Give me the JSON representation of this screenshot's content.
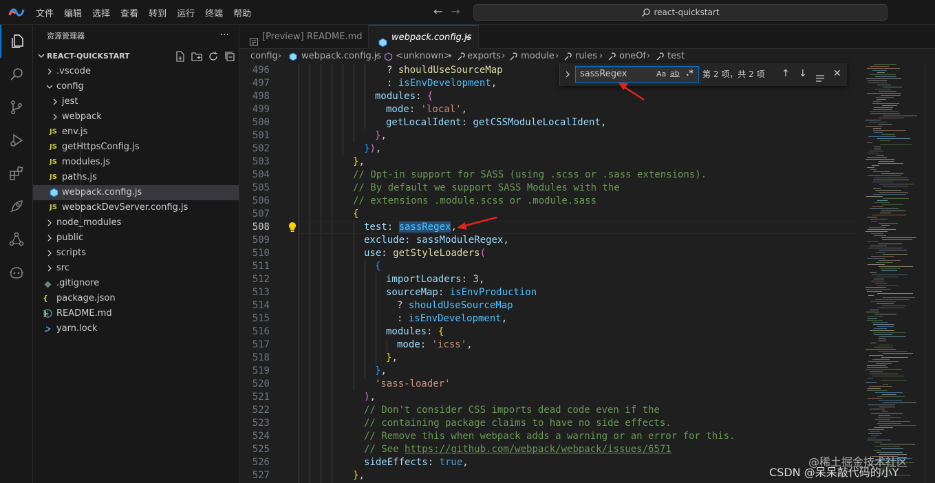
{
  "menubar": {
    "items": [
      "文件",
      "编辑",
      "选择",
      "查看",
      "转到",
      "运行",
      "终端",
      "帮助"
    ]
  },
  "command_center": {
    "text": "react-quickstart"
  },
  "sidebar": {
    "header": "资源管理器",
    "more": "···",
    "section_title": "REACT-QUICKSTART",
    "tree": [
      {
        "label": ".vscode",
        "kind": "folder",
        "expanded": false
      },
      {
        "label": "config",
        "kind": "folder",
        "expanded": true
      },
      {
        "label": "jest",
        "kind": "folder",
        "expanded": false
      },
      {
        "label": "webpack",
        "kind": "folder",
        "expanded": false
      },
      {
        "label": "env.js",
        "kind": "js"
      },
      {
        "label": "getHttpsConfig.js",
        "kind": "js"
      },
      {
        "label": "modules.js",
        "kind": "js"
      },
      {
        "label": "paths.js",
        "kind": "js"
      },
      {
        "label": "webpack.config.js",
        "kind": "webpack",
        "selected": true
      },
      {
        "label": "webpackDevServer.config.js",
        "kind": "js"
      },
      {
        "label": "node_modules",
        "kind": "folder",
        "expanded": false
      },
      {
        "label": "public",
        "kind": "folder",
        "expanded": false
      },
      {
        "label": "scripts",
        "kind": "folder",
        "expanded": false
      },
      {
        "label": "src",
        "kind": "folder",
        "expanded": false
      },
      {
        "label": ".gitignore",
        "kind": "git"
      },
      {
        "label": "package.json",
        "kind": "json"
      },
      {
        "label": "README.md",
        "kind": "info"
      },
      {
        "label": "yarn.lock",
        "kind": "yarn"
      }
    ],
    "js_badge": "JS",
    "json_badge": "{ }"
  },
  "tabs": [
    {
      "label": "[Preview] README.md",
      "active": false
    },
    {
      "label": "webpack.config.js",
      "active": true,
      "close": "×"
    }
  ],
  "breadcrumbs": [
    "config",
    "webpack.config.js",
    "<unknown>",
    "exports",
    "module",
    "rules",
    "oneOf",
    "test"
  ],
  "find_widget": {
    "query": "sassRegex",
    "case_label": "Aa",
    "word_label": "ab",
    "regex_label": ".*",
    "result_count": "第 2 项，共 2 项"
  },
  "code": {
    "current_line": "508",
    "lines": [
      {
        "n": "496"
      },
      {
        "n": "497"
      },
      {
        "n": "498"
      },
      {
        "n": "499"
      },
      {
        "n": "500"
      },
      {
        "n": "501"
      },
      {
        "n": "502"
      },
      {
        "n": "503"
      },
      {
        "n": "504"
      },
      {
        "n": "505"
      },
      {
        "n": "506"
      },
      {
        "n": "507"
      },
      {
        "n": "508"
      },
      {
        "n": "509"
      },
      {
        "n": "510"
      },
      {
        "n": "511"
      },
      {
        "n": "512"
      },
      {
        "n": "513"
      },
      {
        "n": "514"
      },
      {
        "n": "515"
      },
      {
        "n": "516"
      },
      {
        "n": "517"
      },
      {
        "n": "518"
      },
      {
        "n": "519"
      },
      {
        "n": "520"
      },
      {
        "n": "521"
      },
      {
        "n": "522"
      },
      {
        "n": "523"
      },
      {
        "n": "524"
      },
      {
        "n": "525"
      },
      {
        "n": "526"
      },
      {
        "n": "527"
      }
    ],
    "tokens": {
      "l496_q": "? ",
      "l496_a": "shouldUseSourceMap",
      "l497_c": ": ",
      "l497_a": "isEnvDevelopment",
      "l497_e": ",",
      "l498_a": "modules",
      "l498_b": ": ",
      "l498_c": "{",
      "l499_a": "mode",
      "l499_b": ": ",
      "l499_c": "'local'",
      "l499_d": ",",
      "l500_a": "getLocalIdent",
      "l500_b": ": ",
      "l500_c": "getCSSModuleLocalIdent",
      "l500_d": ",",
      "l501_a": "}",
      "l501_b": ",",
      "l502_a": "}",
      "l502_b": ")",
      "l502_c": ",",
      "l503_a": "}",
      "l503_b": ",",
      "l504": "// Opt-in support for SASS (using .scss or .sass extensions).",
      "l505": "// By default we support SASS Modules with the",
      "l506": "// extensions .module.scss or .module.sass",
      "l507": "{",
      "l508_a": "test",
      "l508_b": ": ",
      "l508_c": "sassRegex",
      "l508_d": ",",
      "l509_a": "exclude",
      "l509_b": ": ",
      "l509_c": "sassModuleRegex",
      "l509_d": ",",
      "l510_a": "use",
      "l510_b": ": ",
      "l510_c": "getStyleLoaders",
      "l510_d": "(",
      "l511": "{",
      "l512_a": "importLoaders",
      "l512_b": ": ",
      "l512_c": "3",
      "l512_d": ",",
      "l513_a": "sourceMap",
      "l513_b": ": ",
      "l513_c": "isEnvProduction",
      "l514_q": "? ",
      "l514_a": "shouldUseSourceMap",
      "l515_c": ": ",
      "l515_a": "isEnvDevelopment",
      "l515_e": ",",
      "l516_a": "modules",
      "l516_b": ": ",
      "l516_c": "{",
      "l517_a": "mode",
      "l517_b": ": ",
      "l517_c": "'icss'",
      "l517_d": ",",
      "l518_a": "}",
      "l518_b": ",",
      "l519_a": "}",
      "l519_b": ",",
      "l520": "'sass-loader'",
      "l521_a": ")",
      "l521_b": ",",
      "l522": "// Don't consider CSS imports dead code even if the",
      "l523": "// containing package claims to have no side effects.",
      "l524": "// Remove this when webpack adds a warning or an error for this.",
      "l525_a": "// See ",
      "l525_b": "https://github.com/webpack/webpack/issues/6571",
      "l526_a": "sideEffects",
      "l526_b": ": ",
      "l526_c": "true",
      "l526_d": ",",
      "l527_a": "}",
      "l527_b": ","
    }
  },
  "watermark": {
    "line1": "@稀土掘金技术社区",
    "line2": "CSDN @呆呆敲代码的小Y"
  },
  "colors": {
    "accent": "#0078d4",
    "annotation_arrow": "#e0241c",
    "selection": "#264f78"
  }
}
